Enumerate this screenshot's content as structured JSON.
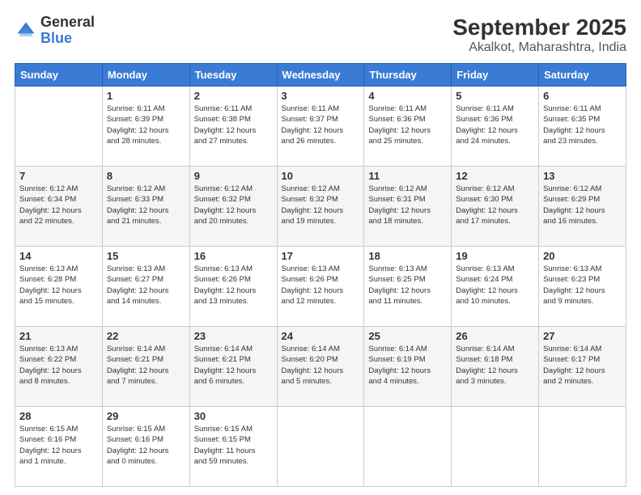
{
  "logo": {
    "general": "General",
    "blue": "Blue"
  },
  "header": {
    "title": "September 2025",
    "subtitle": "Akalkot, Maharashtra, India"
  },
  "days": [
    "Sunday",
    "Monday",
    "Tuesday",
    "Wednesday",
    "Thursday",
    "Friday",
    "Saturday"
  ],
  "weeks": [
    [
      {
        "num": "",
        "info": ""
      },
      {
        "num": "1",
        "info": "Sunrise: 6:11 AM\nSunset: 6:39 PM\nDaylight: 12 hours\nand 28 minutes."
      },
      {
        "num": "2",
        "info": "Sunrise: 6:11 AM\nSunset: 6:38 PM\nDaylight: 12 hours\nand 27 minutes."
      },
      {
        "num": "3",
        "info": "Sunrise: 6:11 AM\nSunset: 6:37 PM\nDaylight: 12 hours\nand 26 minutes."
      },
      {
        "num": "4",
        "info": "Sunrise: 6:11 AM\nSunset: 6:36 PM\nDaylight: 12 hours\nand 25 minutes."
      },
      {
        "num": "5",
        "info": "Sunrise: 6:11 AM\nSunset: 6:36 PM\nDaylight: 12 hours\nand 24 minutes."
      },
      {
        "num": "6",
        "info": "Sunrise: 6:11 AM\nSunset: 6:35 PM\nDaylight: 12 hours\nand 23 minutes."
      }
    ],
    [
      {
        "num": "7",
        "info": "Sunrise: 6:12 AM\nSunset: 6:34 PM\nDaylight: 12 hours\nand 22 minutes."
      },
      {
        "num": "8",
        "info": "Sunrise: 6:12 AM\nSunset: 6:33 PM\nDaylight: 12 hours\nand 21 minutes."
      },
      {
        "num": "9",
        "info": "Sunrise: 6:12 AM\nSunset: 6:32 PM\nDaylight: 12 hours\nand 20 minutes."
      },
      {
        "num": "10",
        "info": "Sunrise: 6:12 AM\nSunset: 6:32 PM\nDaylight: 12 hours\nand 19 minutes."
      },
      {
        "num": "11",
        "info": "Sunrise: 6:12 AM\nSunset: 6:31 PM\nDaylight: 12 hours\nand 18 minutes."
      },
      {
        "num": "12",
        "info": "Sunrise: 6:12 AM\nSunset: 6:30 PM\nDaylight: 12 hours\nand 17 minutes."
      },
      {
        "num": "13",
        "info": "Sunrise: 6:12 AM\nSunset: 6:29 PM\nDaylight: 12 hours\nand 16 minutes."
      }
    ],
    [
      {
        "num": "14",
        "info": "Sunrise: 6:13 AM\nSunset: 6:28 PM\nDaylight: 12 hours\nand 15 minutes."
      },
      {
        "num": "15",
        "info": "Sunrise: 6:13 AM\nSunset: 6:27 PM\nDaylight: 12 hours\nand 14 minutes."
      },
      {
        "num": "16",
        "info": "Sunrise: 6:13 AM\nSunset: 6:26 PM\nDaylight: 12 hours\nand 13 minutes."
      },
      {
        "num": "17",
        "info": "Sunrise: 6:13 AM\nSunset: 6:26 PM\nDaylight: 12 hours\nand 12 minutes."
      },
      {
        "num": "18",
        "info": "Sunrise: 6:13 AM\nSunset: 6:25 PM\nDaylight: 12 hours\nand 11 minutes."
      },
      {
        "num": "19",
        "info": "Sunrise: 6:13 AM\nSunset: 6:24 PM\nDaylight: 12 hours\nand 10 minutes."
      },
      {
        "num": "20",
        "info": "Sunrise: 6:13 AM\nSunset: 6:23 PM\nDaylight: 12 hours\nand 9 minutes."
      }
    ],
    [
      {
        "num": "21",
        "info": "Sunrise: 6:13 AM\nSunset: 6:22 PM\nDaylight: 12 hours\nand 8 minutes."
      },
      {
        "num": "22",
        "info": "Sunrise: 6:14 AM\nSunset: 6:21 PM\nDaylight: 12 hours\nand 7 minutes."
      },
      {
        "num": "23",
        "info": "Sunrise: 6:14 AM\nSunset: 6:21 PM\nDaylight: 12 hours\nand 6 minutes."
      },
      {
        "num": "24",
        "info": "Sunrise: 6:14 AM\nSunset: 6:20 PM\nDaylight: 12 hours\nand 5 minutes."
      },
      {
        "num": "25",
        "info": "Sunrise: 6:14 AM\nSunset: 6:19 PM\nDaylight: 12 hours\nand 4 minutes."
      },
      {
        "num": "26",
        "info": "Sunrise: 6:14 AM\nSunset: 6:18 PM\nDaylight: 12 hours\nand 3 minutes."
      },
      {
        "num": "27",
        "info": "Sunrise: 6:14 AM\nSunset: 6:17 PM\nDaylight: 12 hours\nand 2 minutes."
      }
    ],
    [
      {
        "num": "28",
        "info": "Sunrise: 6:15 AM\nSunset: 6:16 PM\nDaylight: 12 hours\nand 1 minute."
      },
      {
        "num": "29",
        "info": "Sunrise: 6:15 AM\nSunset: 6:16 PM\nDaylight: 12 hours\nand 0 minutes."
      },
      {
        "num": "30",
        "info": "Sunrise: 6:15 AM\nSunset: 6:15 PM\nDaylight: 11 hours\nand 59 minutes."
      },
      {
        "num": "",
        "info": ""
      },
      {
        "num": "",
        "info": ""
      },
      {
        "num": "",
        "info": ""
      },
      {
        "num": "",
        "info": ""
      }
    ]
  ]
}
